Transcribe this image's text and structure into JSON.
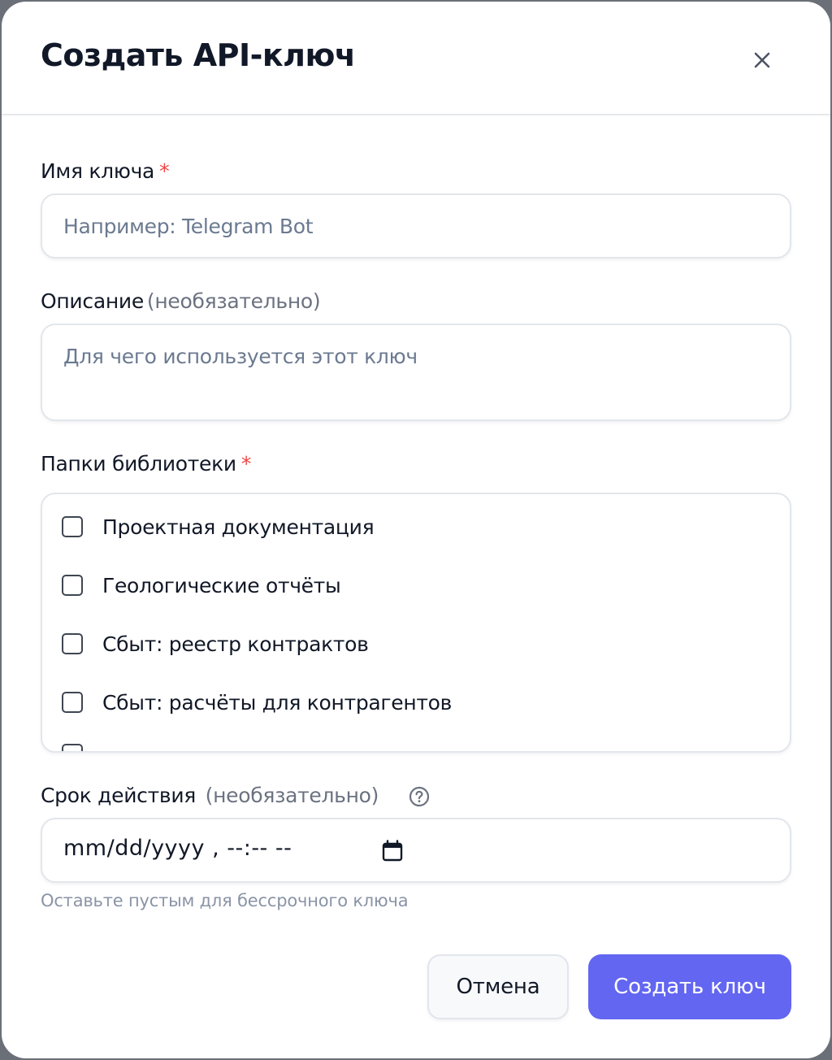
{
  "dialog": {
    "title": "Создать API-ключ",
    "close_icon": "close-icon"
  },
  "key_name": {
    "label": "Имя ключа",
    "required_mark": "*",
    "placeholder": "Например: Telegram Bot",
    "value": ""
  },
  "description": {
    "label": "Описание",
    "optional_note": "(необязательно)",
    "placeholder": "Для чего используется этот ключ",
    "value": ""
  },
  "folders": {
    "label": "Папки библиотеки",
    "required_mark": "*",
    "items": [
      {
        "label": "Проектная документация",
        "checked": false
      },
      {
        "label": "Геологические отчёты",
        "checked": false
      },
      {
        "label": "Сбыт: реестр контрактов",
        "checked": false
      },
      {
        "label": "Сбыт: расчёты для контрагентов",
        "checked": false
      }
    ]
  },
  "expiry": {
    "label": "Срок действия",
    "optional_note": "(необязательно)",
    "help_icon": "question-circle-icon",
    "value": "mm/dd/yyyy , --:-- --",
    "calendar_icon": "calendar-icon",
    "hint": "Оставьте пустым для бессрочного ключа"
  },
  "actions": {
    "cancel_label": "Отмена",
    "create_label": "Создать ключ"
  },
  "colors": {
    "primary": "#6366f1",
    "required": "#ef4444",
    "placeholder": "#6b7a90",
    "muted": "#8a94a6"
  }
}
